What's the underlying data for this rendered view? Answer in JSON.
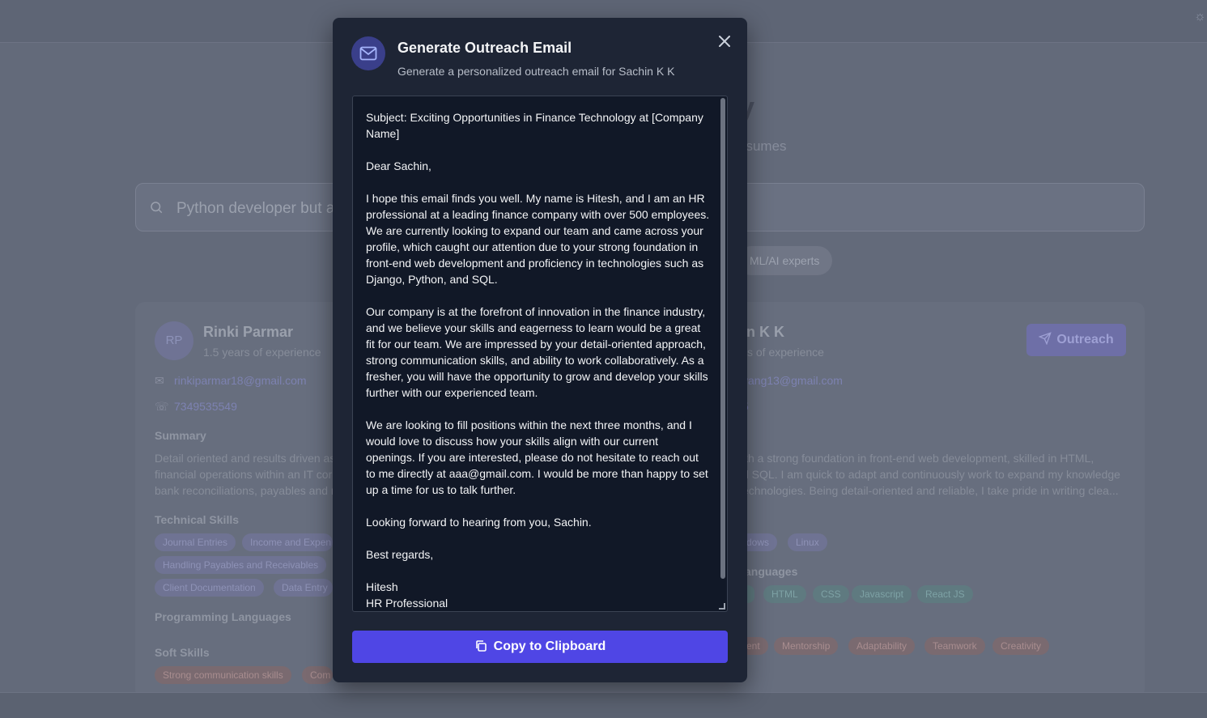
{
  "background": {
    "hero_title": "y",
    "hero_subtitle": "esumes",
    "search": {
      "value": "Python developer but als"
    },
    "chip": "ML/AI experts",
    "left_card": {
      "initials": "RP",
      "name": "Rinki Parmar",
      "experience": "1.5 years of experience",
      "email": "rinkiparmar18@gmail.com",
      "phone": "7349535549",
      "summary_heading": "Summary",
      "summary_lines": [
        "Detail oriented and results driven as",
        "financial operations within an IT cor",
        "bank reconciliations, payables and r"
      ],
      "technical_heading": "Technical Skills",
      "technical_tags": [
        "Journal Entries",
        "Income and Expen",
        "Handling Payables and Receivables",
        "Client Documentation",
        "Data Entry"
      ],
      "programming_heading": "Programming Languages",
      "soft_heading": "Soft Skills",
      "soft_tags": [
        "Strong communication skills",
        "Com"
      ]
    },
    "right_card": {
      "name": "in K K",
      "experience": "s of experience",
      "email": "yang13@gmail.com",
      "phone": "5",
      "summary_lines": [
        "ith a strong foundation in front-end web development, skilled in HTML,",
        "d SQL. I am quick to adapt and continuously work to expand my knowledge",
        "echnologies. Being detail-oriented and reliable, I take pride in writing clea..."
      ],
      "outreach_label": "Outreach",
      "technical_tags": [
        "dows",
        "Linux"
      ],
      "programming_heading": "anguages",
      "programming_tags": [
        "HTML",
        "CSS",
        "Javascript",
        "React JS"
      ],
      "soft_tags": [
        "ent",
        "Mentorship",
        "Adaptability",
        "Teamwork",
        "Creativity"
      ]
    }
  },
  "modal": {
    "title": "Generate Outreach Email",
    "subtitle": "Generate a personalized outreach email for Sachin K K",
    "email_body": "Subject: Exciting Opportunities in Finance Technology at [Company Name]\n\nDear Sachin,\n\nI hope this email finds you well. My name is Hitesh, and I am an HR professional at a leading finance company with over 500 employees. We are currently looking to expand our team and came across your profile, which caught our attention due to your strong foundation in front-end web development and proficiency in technologies such as Django, Python, and SQL.\n\nOur company is at the forefront of innovation in the finance industry, and we believe your skills and eagerness to learn would be a great fit for our team. We are impressed by your detail-oriented approach, strong communication skills, and ability to work collaboratively. As a fresher, you will have the opportunity to grow and develop your skills further with our experienced team.\n\nWe are looking to fill positions within the next three months, and I would love to discuss how your skills align with our current openings. If you are interested, please do not hesitate to reach out to me directly at aaa@gmail.com. I would be more than happy to set up a time for us to talk further.\n\nLooking forward to hearing from you, Sachin.\n\nBest regards,\n\nHitesh\nHR Professional",
    "copy_label": "Copy to Clipboard"
  },
  "colors": {
    "accent": "#4f46e5",
    "modal_bg": "#1e2535",
    "textarea_bg": "#111827"
  },
  "icons": {
    "header": "mail-icon",
    "close": "close-icon",
    "copy": "clipboard-icon",
    "search": "search-icon"
  }
}
